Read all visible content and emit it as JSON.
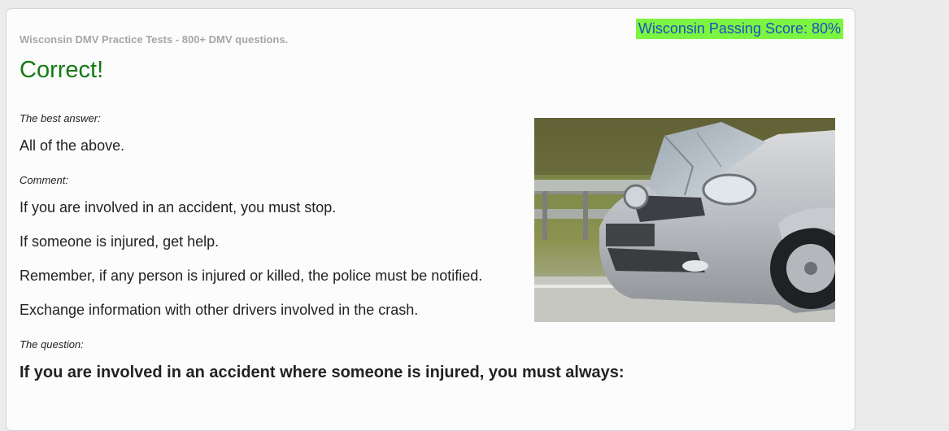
{
  "header": {
    "site_title": "Wisconsin DMV Practice Tests - 800+ DMV questions.",
    "passing_score": "Wisconsin Passing Score: 80%"
  },
  "result": {
    "heading": "Correct!"
  },
  "answer": {
    "label": "The best answer:",
    "text": "All of the above."
  },
  "comment": {
    "label": "Comment:",
    "lines": [
      "If you are involved in an accident, you must stop.",
      "If someone is injured, get help.",
      "Remember, if any person is injured or killed, the police must be notified.",
      "Exchange information with other drivers involved in the crash."
    ]
  },
  "question": {
    "label": "The question:",
    "text": "If you are involved in an accident where someone is injured, you must always:"
  },
  "colors": {
    "correct": "#137a13",
    "passing_bg": "#7cf542",
    "passing_text": "#1d4fc1"
  }
}
